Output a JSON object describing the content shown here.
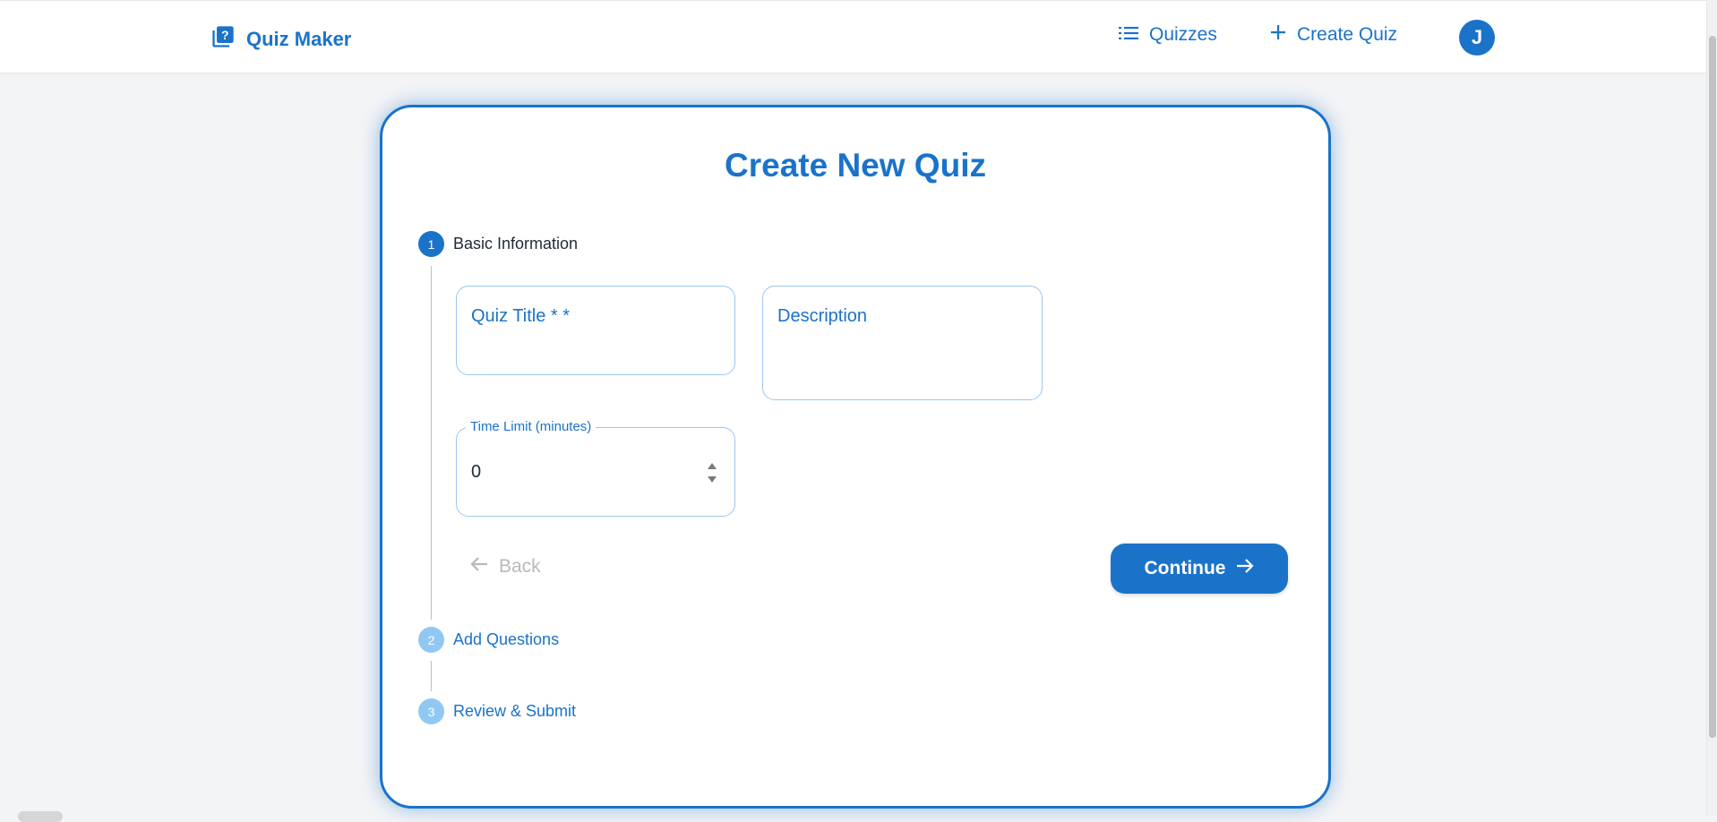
{
  "app": {
    "title": "Quiz Maker",
    "colors": {
      "primary": "#1a73c9",
      "step_inactive": "#90c8f3",
      "border": "#9cc7ee"
    },
    "logo_icon": "quiz-icon"
  },
  "nav": {
    "items": [
      {
        "label": "Quizzes",
        "icon": "list-icon"
      },
      {
        "label": "Create Quiz",
        "icon": "plus-icon"
      }
    ],
    "avatar_initial": "J"
  },
  "card": {
    "title": "Create New Quiz"
  },
  "stepper": {
    "steps": [
      {
        "number": "1",
        "label": "Basic Information",
        "state": "active"
      },
      {
        "number": "2",
        "label": "Add Questions",
        "state": "inactive"
      },
      {
        "number": "3",
        "label": "Review & Submit",
        "state": "inactive"
      }
    ]
  },
  "form": {
    "quiz_title": {
      "label": "Quiz Title * *",
      "value": ""
    },
    "description": {
      "label": "Description",
      "value": ""
    },
    "time_limit": {
      "label": "Time Limit (minutes)",
      "value": "0"
    }
  },
  "actions": {
    "back_label": "Back",
    "continue_label": "Continue"
  }
}
